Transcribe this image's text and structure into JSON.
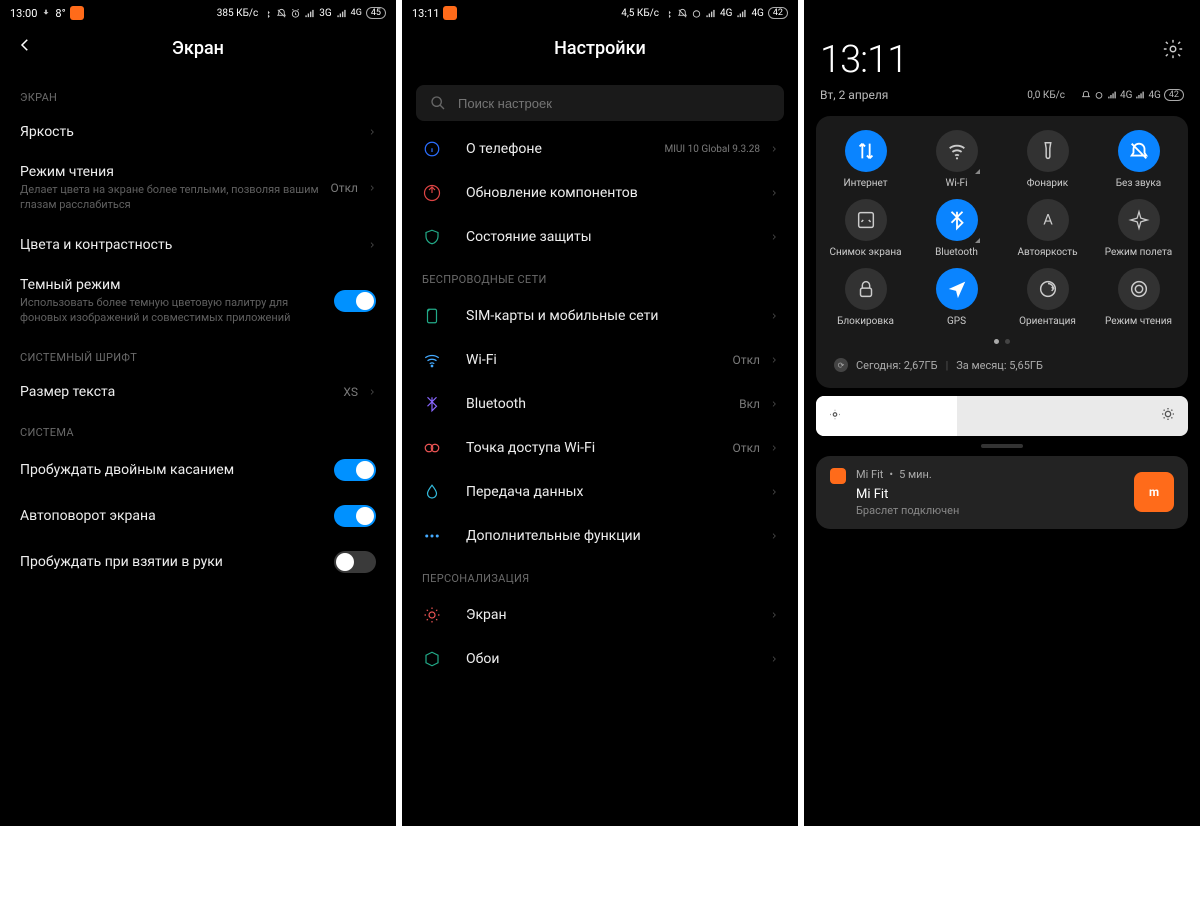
{
  "panel1": {
    "status": {
      "time": "13:00",
      "temp": "8°",
      "speed": "385 КБ/с",
      "net1": "3G",
      "net2": "4G",
      "battery": "45"
    },
    "title": "Экран",
    "section_screen": "ЭКРАН",
    "brightness": "Яркость",
    "reading_mode": {
      "title": "Режим чтения",
      "sub": "Делает цвета на экране более теплыми, позволяя вашим глазам расслабиться",
      "value": "Откл"
    },
    "colors": "Цвета и контрастность",
    "dark_mode": {
      "title": "Темный режим",
      "sub": "Использовать более темную цветовую палитру для фоновых изображений и совместимых приложений"
    },
    "section_font": "СИСТЕМНЫЙ ШРИФТ",
    "text_size": {
      "title": "Размер текста",
      "value": "XS"
    },
    "section_system": "СИСТЕМА",
    "wake_double_tap": "Пробуждать двойным касанием",
    "auto_rotate": "Автоповорот экрана",
    "wake_on_pickup": "Пробуждать при взятии в руки"
  },
  "panel2": {
    "status": {
      "time": "13:11",
      "speed": "4,5 КБ/с",
      "net1": "4G",
      "net2": "4G",
      "battery": "42"
    },
    "title": "Настройки",
    "search_placeholder": "Поиск настроек",
    "about": {
      "title": "О телефоне",
      "value": "MIUI 10 Global 9.3.28"
    },
    "update": "Обновление компонентов",
    "security": "Состояние защиты",
    "section_wireless": "БЕСПРОВОДНЫЕ СЕТИ",
    "sim": "SIM-карты и мобильные сети",
    "wifi": {
      "title": "Wi-Fi",
      "value": "Откл"
    },
    "bluetooth": {
      "title": "Bluetooth",
      "value": "Вкл"
    },
    "hotspot": {
      "title": "Точка доступа Wi-Fi",
      "value": "Откл"
    },
    "data_transfer": "Передача данных",
    "more": "Дополнительные функции",
    "section_personal": "ПЕРСОНАЛИЗАЦИЯ",
    "display": "Экран",
    "wallpaper": "Обои"
  },
  "panel3": {
    "clock": "13:11",
    "date": "Вт, 2 апреля",
    "status": {
      "speed": "0,0 КБ/с",
      "net1": "4G",
      "net2": "4G",
      "battery": "42"
    },
    "tiles": [
      {
        "label": "Интернет",
        "active": true,
        "icon": "data"
      },
      {
        "label": "Wi-Fi",
        "active": false,
        "icon": "wifi",
        "corner": true
      },
      {
        "label": "Фонарик",
        "active": false,
        "icon": "torch"
      },
      {
        "label": "Без звука",
        "active": true,
        "icon": "mute"
      },
      {
        "label": "Снимок экрана",
        "active": false,
        "icon": "screenshot"
      },
      {
        "label": "Bluetooth",
        "active": true,
        "icon": "bt",
        "corner": true
      },
      {
        "label": "Автояркость",
        "active": false,
        "icon": "autobright"
      },
      {
        "label": "Режим полета",
        "active": false,
        "icon": "airplane"
      },
      {
        "label": "Блокировка",
        "active": false,
        "icon": "lock"
      },
      {
        "label": "GPS",
        "active": true,
        "icon": "gps"
      },
      {
        "label": "Ориентация",
        "active": false,
        "icon": "rotate"
      },
      {
        "label": "Режим чтения",
        "active": false,
        "icon": "read"
      }
    ],
    "data_today": "Сегодня: 2,67ГБ",
    "data_month": "За месяц: 5,65ГБ",
    "notif": {
      "app": "Mi Fit",
      "time": "5 мин.",
      "title": "Mi Fit",
      "sub": "Браслет подключен"
    }
  }
}
